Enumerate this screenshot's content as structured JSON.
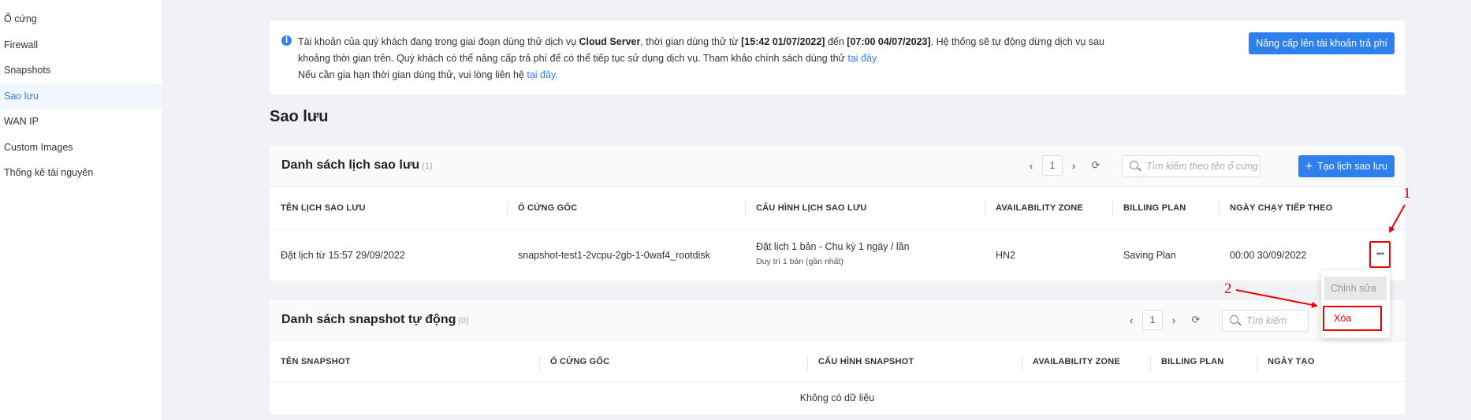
{
  "sidebar": {
    "items": [
      {
        "label": "Ổ cứng"
      },
      {
        "label": "Firewall"
      },
      {
        "label": "Snapshots"
      },
      {
        "label": "Sao lưu"
      },
      {
        "label": "WAN IP"
      },
      {
        "label": "Custom Images"
      },
      {
        "label": "Thống kê tài nguyên"
      }
    ],
    "active_index": 3
  },
  "notice": {
    "t1": "Tài khoản của quý khách đang trong giai đoạn dùng thử dịch vụ ",
    "b1": "Cloud Server",
    "t2": ", thời gian dùng thử từ ",
    "b2": "[15:42 01/07/2022]",
    "t3": " đến ",
    "b3": "[07:00 04/07/2023]",
    "t4": ". Hệ thống sẽ tự động dừng dịch vụ sau khoảng thời gian trên. Quý khách có thể nâng cấp trả phí để có thể tiếp tục sử dụng dịch vụ. Tham khảo chính sách dùng thử ",
    "link1": "tại đây.",
    "t5": "Nếu cần gia hạn thời gian dùng thử, vui lòng liên hệ ",
    "link2": "tại đây.",
    "upgrade_label": "Nâng cấp lên tài khoản trả phí"
  },
  "page_title": "Sao lưu",
  "schedules": {
    "title": "Danh sách lịch sao lưu",
    "count": "(1)",
    "page": "1",
    "search_placeholder": "Tìm kiếm theo tên ổ cứng",
    "create_label": "Tạo lịch sao lưu",
    "columns": [
      "TÊN LỊCH SAO LƯU",
      "Ổ CỨNG GỐC",
      "CẤU HÌNH LỊCH SAO LƯU",
      "AVAILABILITY ZONE",
      "BILLING PLAN",
      "NGÀY CHẠY TIẾP THEO"
    ],
    "rows": [
      {
        "name": "Đặt lịch từ 15:57 29/09/2022",
        "disk": "snapshot-test1-2vcpu-2gb-1-0waf4_rootdisk",
        "config": "Đặt lịch 1 bản - Chu kỳ 1 ngày / lần",
        "config_sub": "Duy trì 1 bản (gần nhất)",
        "zone": "HN2",
        "billing": "Saving Plan",
        "next_run": "00:00 30/09/2022",
        "more": "•••"
      }
    ]
  },
  "snapshots": {
    "title": "Danh sách snapshot tự động",
    "count": "(0)",
    "page": "1",
    "search_placeholder": "Tìm kiếm",
    "columns": [
      "TÊN SNAPSHOT",
      "Ổ CỨNG GỐC",
      "CẤU HÌNH SNAPSHOT",
      "AVAILABILITY ZONE",
      "BILLING PLAN",
      "NGÀY TẠO"
    ],
    "empty_text": "Không có dữ liệu"
  },
  "dropdown": {
    "edit_label": "Chỉnh sửa",
    "delete_label": "Xóa"
  },
  "annotations": {
    "one": "1",
    "two": "2"
  },
  "colors": {
    "accent": "#2f80ed",
    "annotation": "#e00000",
    "background": "#f0f2f5"
  }
}
